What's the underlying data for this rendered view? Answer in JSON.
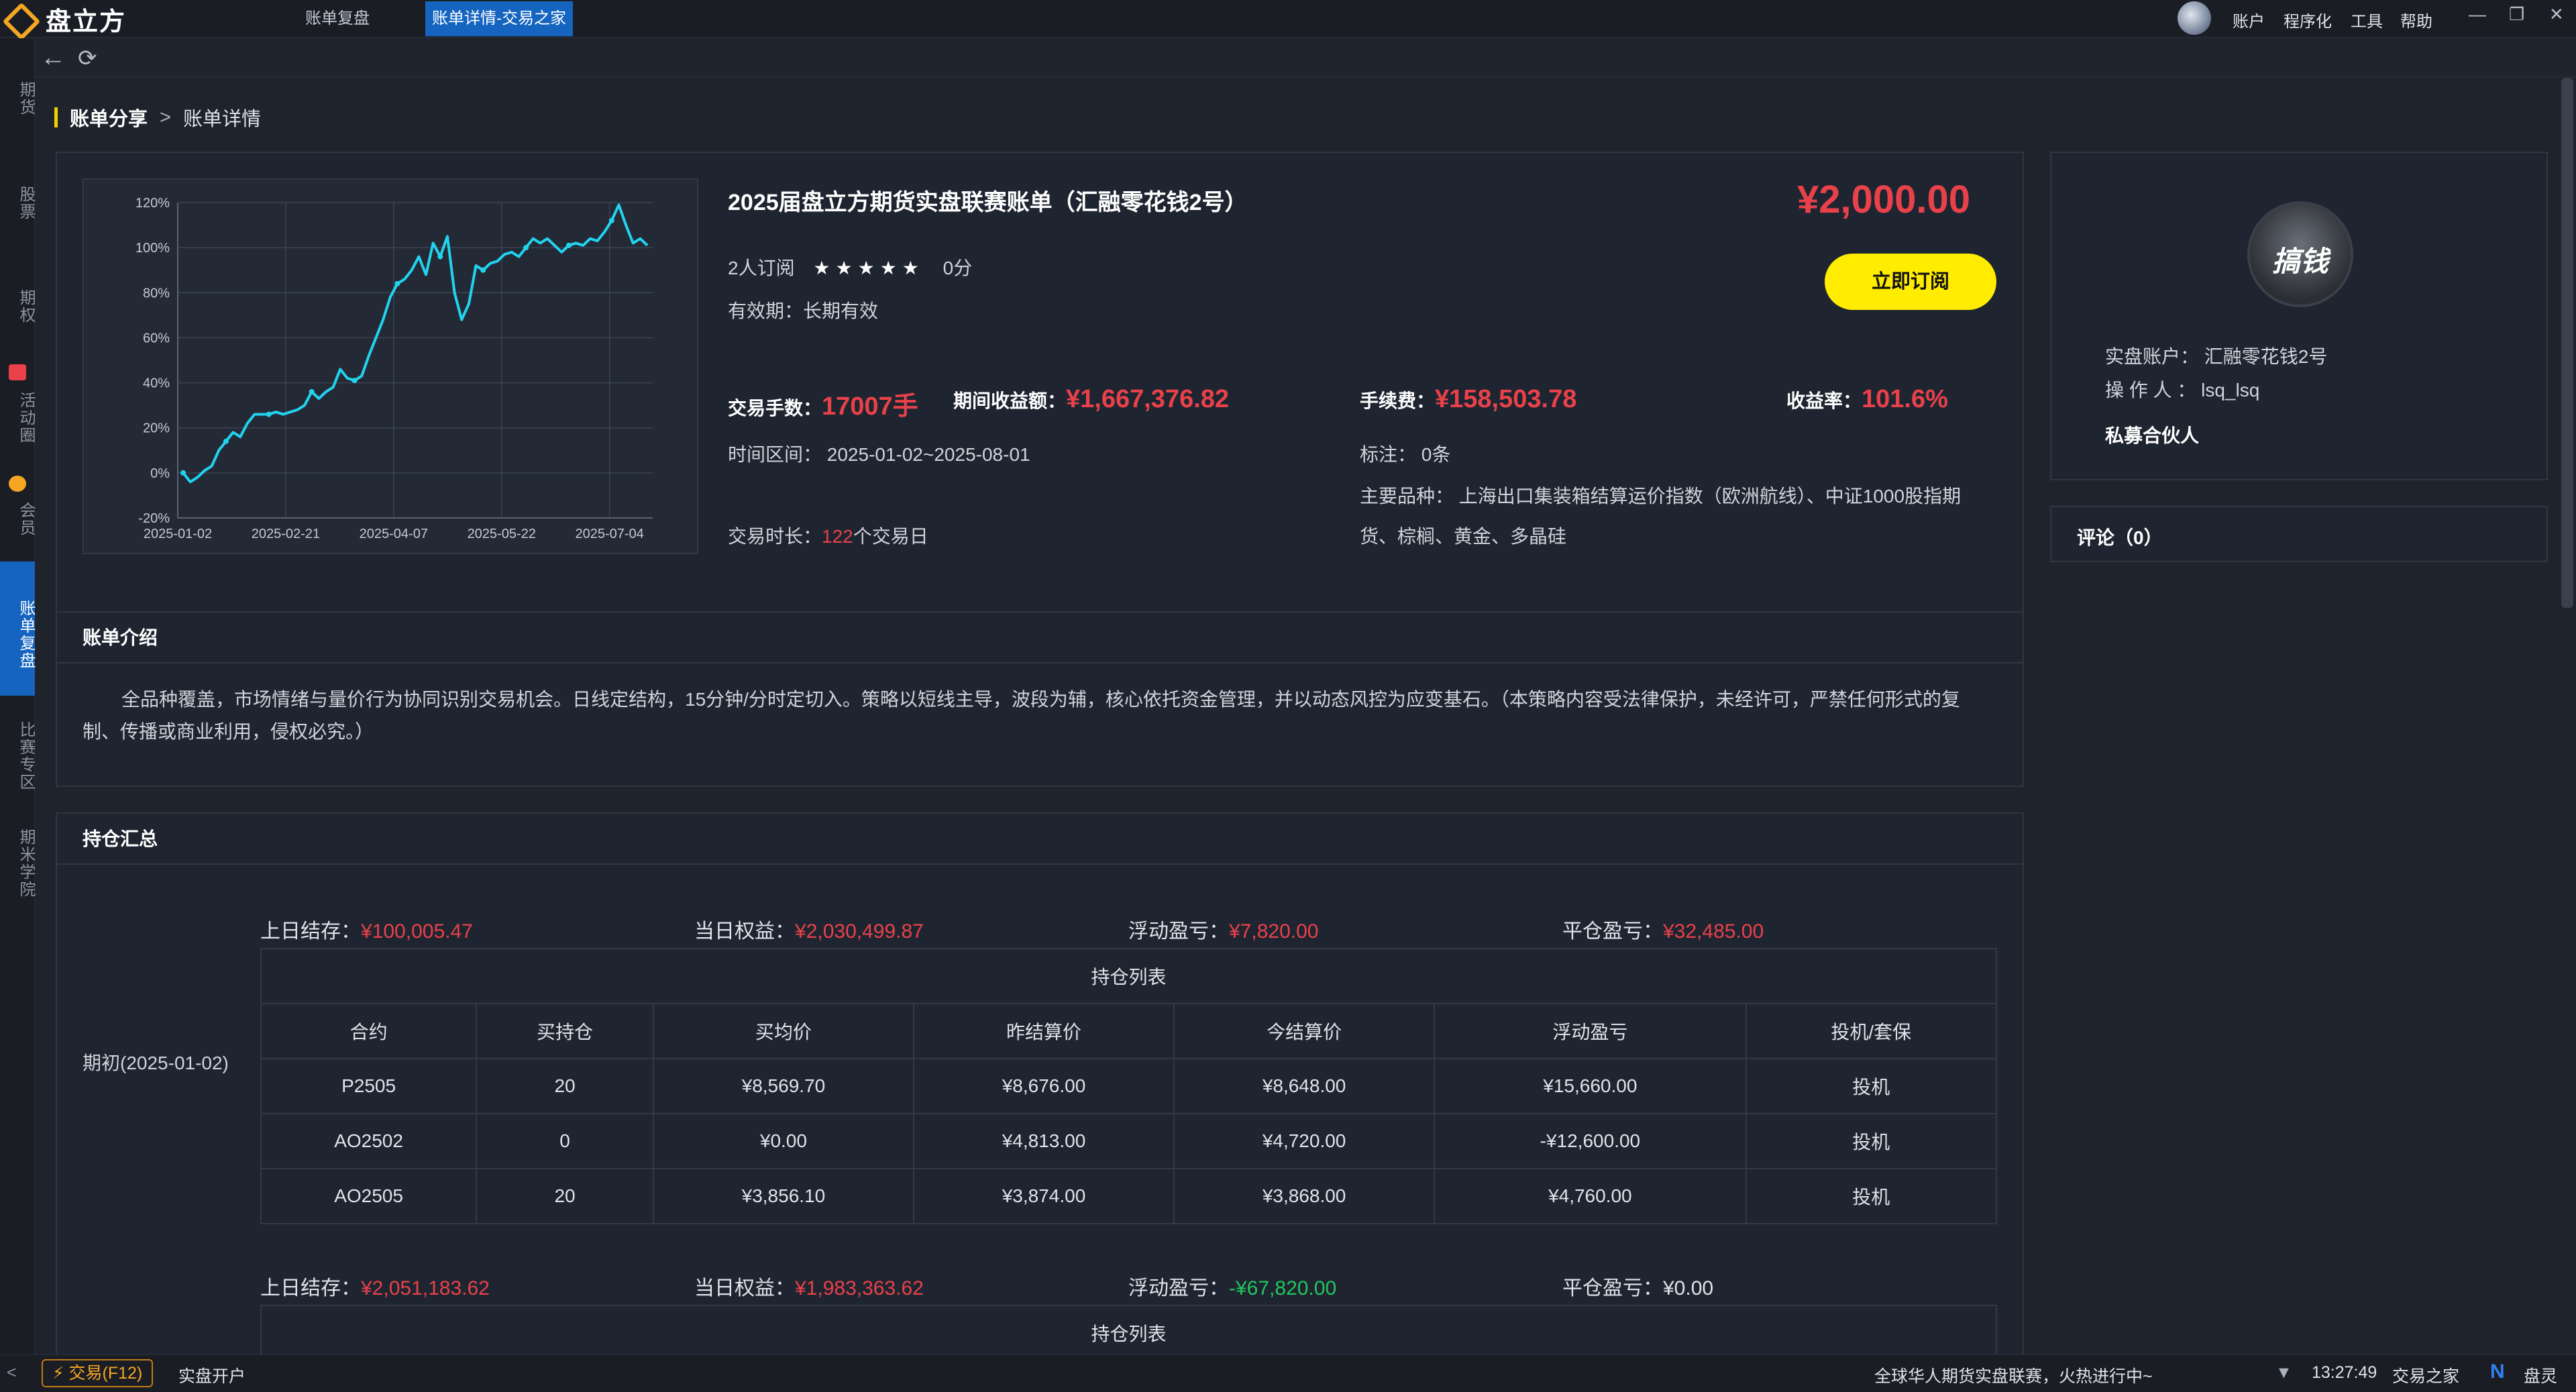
{
  "app": {
    "name": "盘立方"
  },
  "tabs": [
    {
      "label": "账单复盘"
    },
    {
      "label": "账单详情-交易之家"
    }
  ],
  "top_menu": [
    "账户",
    "程序化",
    "工具",
    "帮助"
  ],
  "sidebar": [
    "期货",
    "股票",
    "期权",
    "活动圈",
    "会员",
    "账单复盘",
    "比赛专区",
    "期米学院"
  ],
  "breadcrumb": {
    "root": "账单分享",
    "sep": ">",
    "current": "账单详情"
  },
  "bill": {
    "title": "2025届盘立方期货实盘联赛账单（汇融零花钱2号）",
    "price": "¥2,000.00",
    "subscribers": "2人订阅",
    "stars": "★★★★★",
    "score": "0分",
    "validity": "有效期：长期有效",
    "subscribe_button": "立即订阅",
    "trades_label": "交易手数：",
    "trades": "17007手",
    "profit_label": "期间收益额：",
    "profit": "¥1,667,376.82",
    "fee_label": "手续费：",
    "fee": "¥158,503.78",
    "return_label": "收益率：",
    "return": "101.6%",
    "period": "时间区间：  2025-01-02~2025-08-01",
    "notes": "标注：  0条",
    "products_line1": "主要品种：  上海出口集装箱结算运价指数（欧洲航线）、中证1000股指期",
    "products_line2": "货、棕榈、黄金、多晶硅",
    "duration_label": "交易时长：",
    "duration_days": "122",
    "duration_unit": "个交易日"
  },
  "account": {
    "real_account": "实盘账户：  汇融零花钱2号",
    "operator": "操  作  人  ：  lsq_lsq",
    "role": "私募合伙人",
    "avatar_text": "搞钱"
  },
  "comments": {
    "label": "评论（0）"
  },
  "intro": {
    "header": "账单介绍",
    "line1": "全品种覆盖，市场情绪与量价行为协同识别交易机会。日线定结构，15分钟/分时定切入。策略以短线主导，波段为辅，核心依托资金管理，并以动态风控为应变基石。（本策略内容受法律保护，未经许可，严禁任何形式的复",
    "line2": "制、传播或商业利用，侵权必究。）"
  },
  "positions": {
    "header": "持仓汇总",
    "period_label": "期初(2025-01-02)",
    "list_caption": "持仓列表",
    "columns": [
      "合约",
      "买持仓",
      "买均价",
      "昨结算价",
      "今结算价",
      "浮动盈亏",
      "投机/套保"
    ],
    "block1": {
      "prev_label": "上日结存：",
      "prev": "¥100,005.47",
      "equity_label": "当日权益：",
      "equity": "¥2,030,499.87",
      "float_label": "浮动盈亏：",
      "float": "¥7,820.00",
      "close_label": "平仓盈亏：",
      "close": "¥32,485.00",
      "rows": [
        [
          "P2505",
          "20",
          "¥8,569.70",
          "¥8,676.00",
          "¥8,648.00",
          "¥15,660.00",
          "投机"
        ],
        [
          "AO2502",
          "0",
          "¥0.00",
          "¥4,813.00",
          "¥4,720.00",
          "-¥12,600.00",
          "投机"
        ],
        [
          "AO2505",
          "20",
          "¥3,856.10",
          "¥3,874.00",
          "¥3,868.00",
          "¥4,760.00",
          "投机"
        ]
      ]
    },
    "block2": {
      "prev_label": "上日结存：",
      "prev": "¥2,051,183.62",
      "equity_label": "当日权益：",
      "equity": "¥1,983,363.62",
      "float_label": "浮动盈亏：",
      "float": "-¥67,820.00",
      "close_label": "平仓盈亏：",
      "close": "¥0.00"
    }
  },
  "statusbar": {
    "collapse": "<",
    "trade_button": "交易(F12)",
    "open_account": "实盘开户",
    "ticker": "全球华人期货实盘联赛，火热进行中~",
    "time": "13:27:49",
    "site": "交易之家",
    "assistant": "盘灵"
  },
  "colors": {
    "accent": "#1565c0",
    "profit": "#e8414a",
    "loss": "#22c55e",
    "button": "#ffec00"
  },
  "chart_data": {
    "type": "line",
    "x_ticks": [
      "2025-01-02",
      "2025-02-21",
      "2025-04-07",
      "2025-05-22",
      "2025-07-04"
    ],
    "y_ticks": [
      "-20%",
      "0%",
      "20%",
      "40%",
      "60%",
      "80%",
      "100%",
      "120%"
    ],
    "ylim": [
      -20,
      120
    ],
    "grid": true,
    "series": [
      {
        "values": [
          0,
          -4,
          -2,
          1,
          3,
          10,
          14,
          18,
          16,
          22,
          26,
          26,
          26,
          27,
          26,
          27,
          28,
          30,
          36,
          33,
          36,
          38,
          46,
          42,
          41,
          43,
          52,
          60,
          68,
          78,
          84,
          86,
          90,
          96,
          88,
          102,
          96,
          105,
          80,
          68,
          75,
          92,
          90,
          93,
          94,
          97,
          98,
          96,
          100,
          104,
          102,
          104,
          101,
          98,
          101,
          102,
          101,
          104,
          103,
          107,
          112,
          119,
          110,
          102,
          104,
          101
        ]
      }
    ]
  }
}
